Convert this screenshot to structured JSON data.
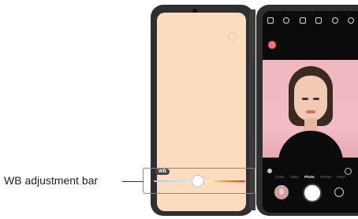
{
  "callout": {
    "label": "WB adjustment bar"
  },
  "wb": {
    "badge": "WB",
    "value_fraction": 0.48
  },
  "camera": {
    "modes": [
      "Close",
      "Video",
      "Photo",
      "Portrait",
      "Pano"
    ],
    "active_mode": "Photo"
  },
  "colors": {
    "left_screen": "#fcdcbf",
    "accent_callout": "#e55a8c",
    "device": "#2f2f30"
  }
}
